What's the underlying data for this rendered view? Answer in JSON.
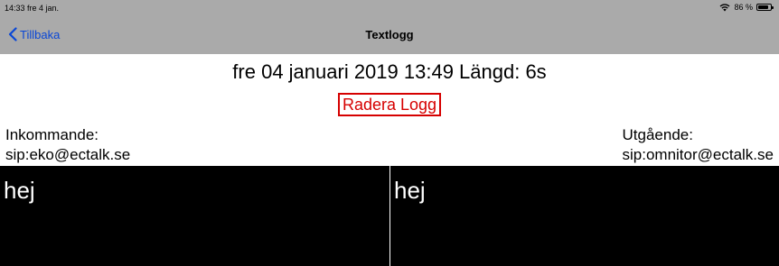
{
  "status_bar": {
    "time_date": "14:33  fre 4 jan.",
    "battery_percent": "86 %",
    "battery_level": 0.86,
    "icons": [
      "wifi-icon",
      "battery-icon"
    ]
  },
  "nav": {
    "back_label": "Tillbaka",
    "title": "Textlogg"
  },
  "log": {
    "headline": "fre 04 januari 2019 13:49 Längd: 6s",
    "delete_label": "Radera Logg",
    "incoming_label": "Inkommande:",
    "incoming_address": "sip:eko@ectalk.se",
    "outgoing_label": "Utgående:",
    "outgoing_address": "sip:omnitor@ectalk.se",
    "incoming_text": "hej",
    "outgoing_text": "hej"
  },
  "colors": {
    "bar_background": "#aaaaaa",
    "accent_blue": "#0a47d6",
    "delete_red": "#d60000",
    "panel_background": "#000000"
  }
}
